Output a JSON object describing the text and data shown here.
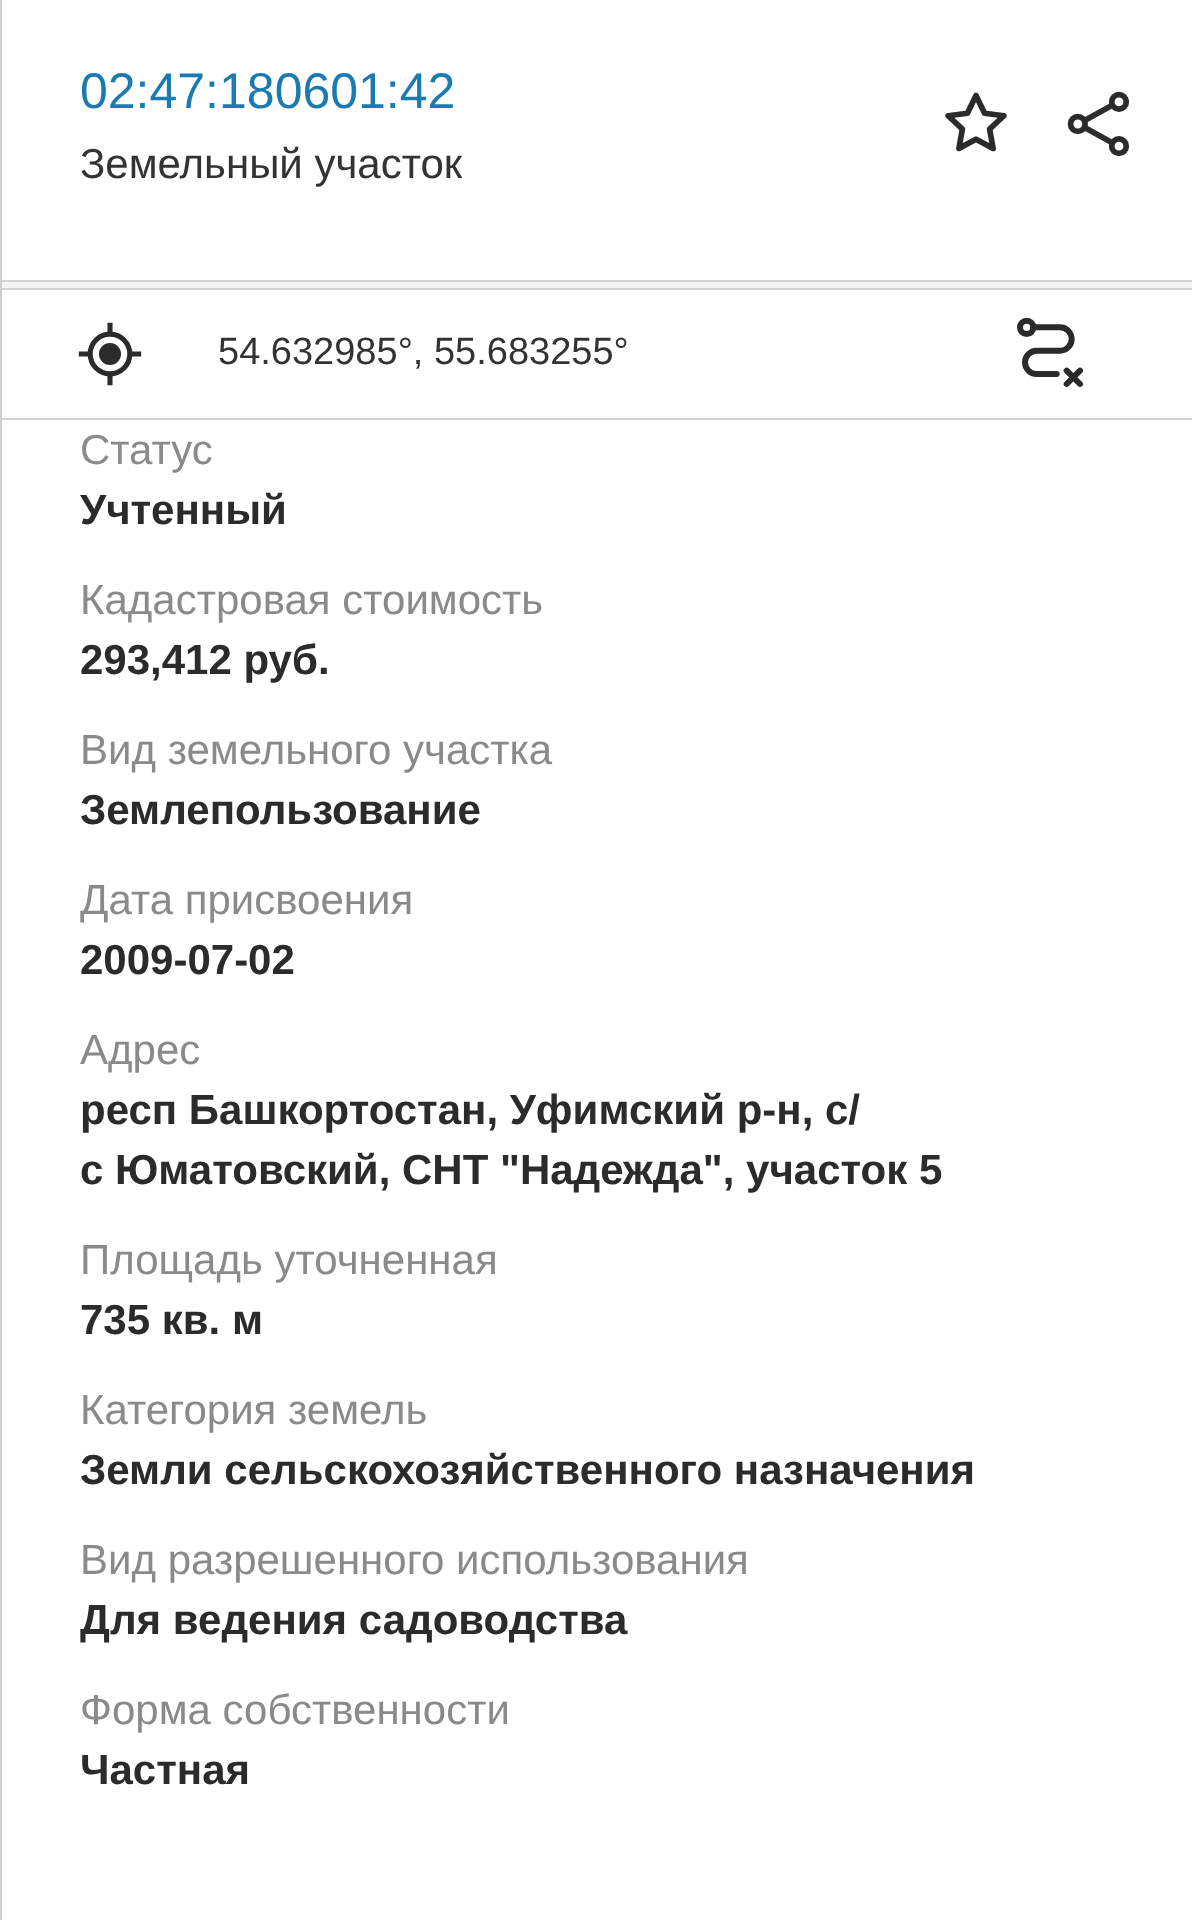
{
  "header": {
    "cadastral_number": "02:47:180601:42",
    "type": "Земельный участок"
  },
  "coordinates": {
    "text": "54.632985°, 55.683255°"
  },
  "fields": [
    {
      "label": "Статус",
      "value_lines": [
        "Учтенный"
      ]
    },
    {
      "label": "Кадастровая стоимость",
      "value_lines": [
        "293,412 руб."
      ]
    },
    {
      "label": "Вид земельного участка",
      "value_lines": [
        "Землепользование"
      ]
    },
    {
      "label": "Дата присвоения",
      "value_lines": [
        "2009-07-02"
      ]
    },
    {
      "label": "Адрес",
      "value_lines": [
        "респ Башкортостан, Уфимский р-н, с/",
        "с Юматовский, СНТ \"Надежда\", участок 5"
      ]
    },
    {
      "label": "Площадь уточненная",
      "value_lines": [
        "735 кв. м"
      ]
    },
    {
      "label": "Категория земель",
      "value_lines": [
        "Земли сельскохозяйственного назначения"
      ]
    },
    {
      "label": "Вид разрешенного использования",
      "value_lines": [
        "Для ведения садоводства"
      ]
    },
    {
      "label": "Форма собственности",
      "value_lines": [
        "Частная"
      ]
    }
  ]
}
